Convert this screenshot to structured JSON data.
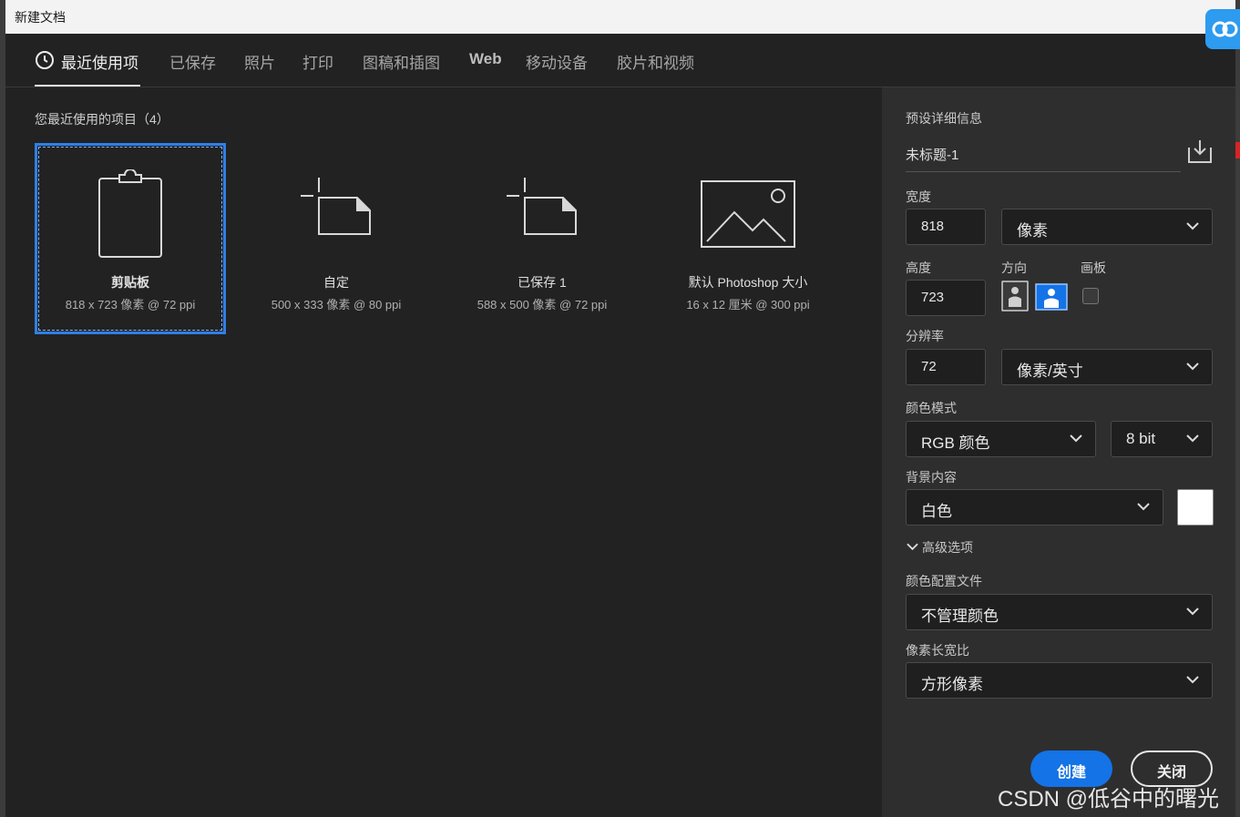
{
  "window": {
    "title": "新建文档"
  },
  "tabs": [
    {
      "label": "最近使用项",
      "active": true
    },
    {
      "label": "已保存"
    },
    {
      "label": "照片"
    },
    {
      "label": "打印"
    },
    {
      "label": "图稿和插图"
    },
    {
      "label": "Web"
    },
    {
      "label": "移动设备"
    },
    {
      "label": "胶片和视频"
    }
  ],
  "recent": {
    "title": "您最近使用的项目（4）",
    "items": [
      {
        "name": "剪贴板",
        "sub": "818 x 723 像素 @ 72 ppi",
        "icon": "clipboard-icon",
        "selected": true
      },
      {
        "name": "自定",
        "sub": "500 x 333 像素 @ 80 ppi",
        "icon": "document-crop-icon"
      },
      {
        "name": "已保存 1",
        "sub": "588 x 500 像素 @ 72 ppi",
        "icon": "document-crop-icon"
      },
      {
        "name": "默认 Photoshop 大小",
        "sub": "16 x 12 厘米 @ 300 ppi",
        "icon": "image-icon"
      }
    ]
  },
  "details": {
    "header": "预设详细信息",
    "preset_name": "未标题-1",
    "width_label": "宽度",
    "width_value": "818",
    "width_unit": "像素",
    "height_label": "高度",
    "height_value": "723",
    "orientation_label": "方向",
    "artboard_label": "画板",
    "resolution_label": "分辨率",
    "resolution_value": "72",
    "resolution_unit": "像素/英寸",
    "color_mode_label": "颜色模式",
    "color_mode": "RGB 颜色",
    "bit_depth": "8 bit",
    "background_label": "背景内容",
    "background": "白色",
    "advanced_label": "高级选项",
    "color_profile_label": "颜色配置文件",
    "color_profile": "不管理颜色",
    "pixel_aspect_label": "像素长宽比",
    "pixel_aspect": "方形像素",
    "create_label": "创建",
    "close_label": "关闭"
  },
  "watermark": "CSDN @低谷中的曙光",
  "colors": {
    "accent": "#1473e6",
    "selection": "#2f7fe6",
    "panel": "#2e2e2e",
    "background": "#222222"
  }
}
